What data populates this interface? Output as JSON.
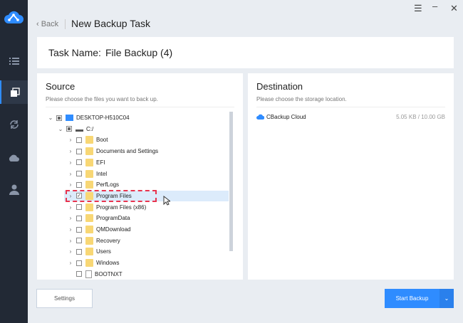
{
  "window": {
    "menu_icon": "hamburger-icon",
    "minimize_icon": "minimize-icon",
    "close_icon": "close-icon"
  },
  "sidebar": {
    "items": [
      {
        "icon": "list-icon"
      },
      {
        "icon": "copy-icon",
        "active": true
      },
      {
        "icon": "sync-icon"
      },
      {
        "icon": "cloud-icon"
      },
      {
        "icon": "user-icon"
      }
    ]
  },
  "header": {
    "back": "‹ Back",
    "title": "New Backup Task"
  },
  "task": {
    "label": "Task Name:",
    "value": "File Backup (4)"
  },
  "source": {
    "title": "Source",
    "subtitle": "Please choose the files you want to back up.",
    "tree": [
      {
        "label": "DESKTOP-H510C04",
        "level": 0,
        "icon": "computer",
        "state": "partial",
        "expand": "open"
      },
      {
        "label": "C:/",
        "level": 1,
        "icon": "drive",
        "state": "partial",
        "expand": "open"
      },
      {
        "label": "Boot",
        "level": 2,
        "icon": "folder",
        "state": "unchecked",
        "expand": "closed"
      },
      {
        "label": "Documents and Settings",
        "level": 2,
        "icon": "folder-link",
        "state": "unchecked",
        "expand": "closed"
      },
      {
        "label": "EFI",
        "level": 2,
        "icon": "folder",
        "state": "unchecked",
        "expand": "closed"
      },
      {
        "label": "Intel",
        "level": 2,
        "icon": "folder",
        "state": "unchecked",
        "expand": "closed"
      },
      {
        "label": "PerfLogs",
        "level": 2,
        "icon": "folder",
        "state": "unchecked",
        "expand": "closed"
      },
      {
        "label": "Program Files",
        "level": 2,
        "icon": "folder",
        "state": "checked",
        "expand": "closed",
        "selected": true
      },
      {
        "label": "Program Files (x86)",
        "level": 2,
        "icon": "folder",
        "state": "unchecked",
        "expand": "closed"
      },
      {
        "label": "ProgramData",
        "level": 2,
        "icon": "folder",
        "state": "unchecked",
        "expand": "closed"
      },
      {
        "label": "QMDownload",
        "level": 2,
        "icon": "folder",
        "state": "unchecked",
        "expand": "closed"
      },
      {
        "label": "Recovery",
        "level": 2,
        "icon": "folder",
        "state": "unchecked",
        "expand": "closed"
      },
      {
        "label": "Users",
        "level": 2,
        "icon": "folder",
        "state": "unchecked",
        "expand": "closed"
      },
      {
        "label": "Windows",
        "level": 2,
        "icon": "folder",
        "state": "unchecked",
        "expand": "closed"
      },
      {
        "label": "BOOTNXT",
        "level": 2,
        "icon": "file",
        "state": "unchecked",
        "expand": "none"
      }
    ]
  },
  "destination": {
    "title": "Destination",
    "subtitle": "Please choose the storage location.",
    "item": {
      "name": "CBackup Cloud",
      "usage": "5.05 KB / 10.00 GB"
    }
  },
  "footer": {
    "settings": "Settings",
    "start": "Start Backup"
  },
  "colors": {
    "accent": "#2f8cff",
    "sidebar": "#222935",
    "highlight": "#e8344e"
  }
}
